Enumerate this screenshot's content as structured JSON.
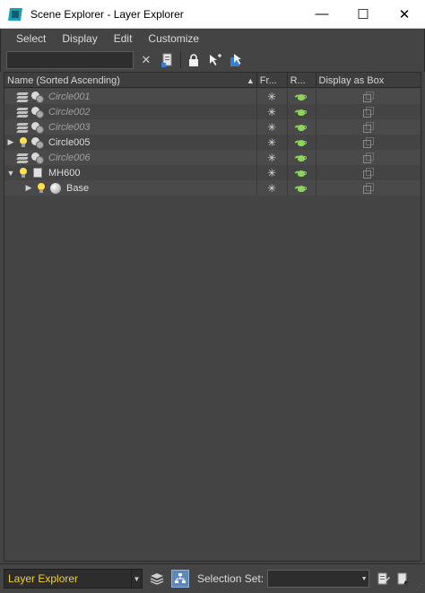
{
  "window": {
    "title": "Scene Explorer - Layer Explorer",
    "minimize_glyph": "—",
    "maximize_glyph": "☐",
    "close_glyph": "✕"
  },
  "menu": [
    "Select",
    "Display",
    "Edit",
    "Customize"
  ],
  "toolbar": {
    "search_value": "",
    "search_placeholder": "",
    "clear_glyph": "✕"
  },
  "columns": {
    "name": "Name (Sorted Ascending)",
    "sort_glyph": "▲",
    "freeze": "Fr...",
    "render": "R...",
    "display_as_box": "Display as Box"
  },
  "rows": [
    {
      "label": "Circle001",
      "italic": true,
      "arrow": "",
      "icons": [
        "layer-icon",
        "object-icon"
      ]
    },
    {
      "label": "Circle002",
      "italic": true,
      "arrow": "",
      "icons": [
        "layer-icon",
        "object-icon"
      ]
    },
    {
      "label": "Circle003",
      "italic": true,
      "arrow": "",
      "icons": [
        "layer-icon",
        "object-icon"
      ]
    },
    {
      "label": "Circle005",
      "italic": false,
      "arrow": "▶",
      "icons": [
        "bulb-icon",
        "object-icon"
      ]
    },
    {
      "label": "Circle006",
      "italic": true,
      "arrow": "",
      "icons": [
        "layer-icon",
        "object-icon"
      ]
    },
    {
      "label": "MH600",
      "italic": false,
      "arrow": "▼",
      "icons": [
        "bulb-icon",
        "layer-doc-icon"
      ]
    },
    {
      "label": "Base",
      "italic": false,
      "arrow": "▶",
      "icons": [
        "bulb-icon",
        "sphere-icon"
      ]
    }
  ],
  "bottom": {
    "explorer_name": "Layer Explorer",
    "selection_set_label": "Selection Set:",
    "selection_set_value": ""
  },
  "colors": {
    "background": "#444444",
    "highlight_text": "#f2d12e",
    "render_green": "#8ed45a",
    "light_bulb": "#ffe04a",
    "active_button": "#5f88b8"
  }
}
